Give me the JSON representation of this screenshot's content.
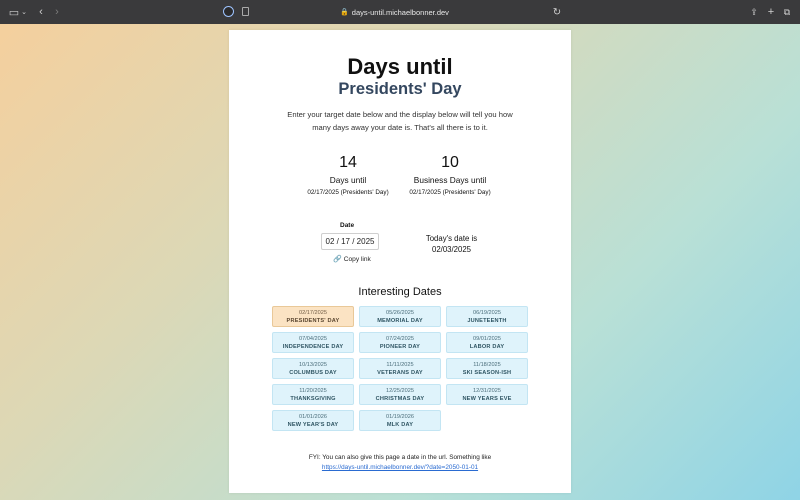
{
  "browser": {
    "url": "days-until.michaelbonner.dev"
  },
  "page": {
    "title": "Days until",
    "subtitle": "Presidents' Day",
    "intro": "Enter your target date below and the display below will tell you how many days away your date is. That's all there is to it.",
    "days": {
      "value": "14",
      "label": "Days until",
      "sub": "02/17/2025 (Presidents' Day)"
    },
    "business": {
      "value": "10",
      "label": "Business Days until",
      "sub": "02/17/2025 (Presidents' Day)"
    },
    "date_label": "Date",
    "date_value": "02 / 17 / 2025",
    "copy_link": "Copy link",
    "today_label": "Today's date is",
    "today_value": "02/03/2025",
    "interesting_title": "Interesting Dates",
    "interesting": [
      {
        "date": "02/17/2025",
        "name": "PRESIDENTS' DAY",
        "active": true
      },
      {
        "date": "05/26/2025",
        "name": "MEMORIAL DAY"
      },
      {
        "date": "06/19/2025",
        "name": "JUNETEENTH"
      },
      {
        "date": "07/04/2025",
        "name": "INDEPENDENCE DAY"
      },
      {
        "date": "07/24/2025",
        "name": "PIONEER DAY"
      },
      {
        "date": "09/01/2025",
        "name": "LABOR DAY"
      },
      {
        "date": "10/13/2025",
        "name": "COLUMBUS DAY"
      },
      {
        "date": "11/11/2025",
        "name": "VETERANS DAY"
      },
      {
        "date": "11/18/2025",
        "name": "SKI SEASON-ISH"
      },
      {
        "date": "11/20/2025",
        "name": "THANKSGIVING"
      },
      {
        "date": "12/25/2025",
        "name": "CHRISTMAS DAY"
      },
      {
        "date": "12/31/2025",
        "name": "NEW YEARS EVE"
      },
      {
        "date": "01/01/2026",
        "name": "NEW YEAR'S DAY"
      },
      {
        "date": "01/19/2026",
        "name": "MLK DAY"
      }
    ],
    "fyi_text": "FYI: You can also give this page a date in the url. Something like",
    "fyi_url": "https://days-until.michaelbonner.dev/?date=2050-01-01"
  }
}
